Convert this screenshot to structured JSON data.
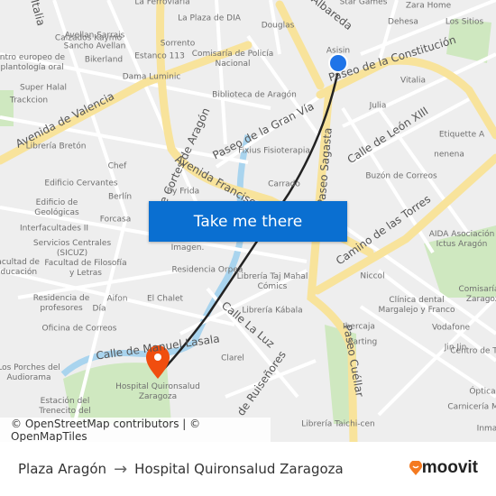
{
  "map": {
    "colors": {
      "major_road": "#f8e39b",
      "minor_road": "#ffffff",
      "river": "#a9d4ee",
      "park": "#cfe8c0",
      "route": "#222222",
      "origin": "#1f74e8",
      "destination": "#f04e0f"
    },
    "streets": [
      "Avenida de Valencia",
      "Calle Cortes de Aragón",
      "Avenida Francisco",
      "Paseo de la Gran Vía",
      "Paseo de la Constitución",
      "Calle de León XIII",
      "Paseo Sagasta",
      "Camino de las Torres",
      "Calle La Luz",
      "Calle de Manuel Lasala",
      "Paseo Cuéllar",
      "de Ruiseñores",
      "Italia",
      "Albareda"
    ],
    "places": [
      "Avellan Sarrais",
      "Sancho Avellan",
      "La Ferroviaria",
      "La Plaza de DIA",
      "Calzados Kaymo",
      "Sorrento",
      "Estanco 113",
      "Comisaría de Policía Nacional",
      "Bikerland",
      "Centro europeo de implantología oral",
      "Dama Luminic",
      "Super Halal",
      "Trackcion",
      "Biblioteca de Aragón",
      "Librería Bretón",
      "Chef",
      "Edificio Cervantes",
      "Berlín",
      "By Frida",
      "Edificio de Geológicas",
      "Forcasa",
      "Interfacultades II",
      "Servicios Centrales (SICUZ)",
      "Facultad de Educación",
      "Facultad de Filosofía y Letras",
      "Residencia de profesores",
      "Aifon",
      "El Chalet",
      "Día",
      "Oficina de Correos",
      "Residencia Orpea",
      "Diagnóstico por Imagen.",
      "Los Porches del Audiorama",
      "Estación del Trenecito del",
      "Hospital Quironsalud Zaragoza",
      "Clarel",
      "Douglas",
      "Star Games",
      "Zara Home",
      "Dehesa",
      "Los Sitios",
      "Vitalia",
      "Julia",
      "Etiquette A",
      "nenena",
      "Fixius Fisioterapia",
      "Buzón de Correos",
      "Carrado",
      "AIDA Asociación Ictus Aragón",
      "Niccol",
      "Comisaría de Zaragoza",
      "Clínica dental Margalejo y Franco",
      "Librería Taj Mahal Cómics",
      "Librería Kábala",
      "Ibercaja",
      "Karting",
      "Vodafone",
      "Jin Jin",
      "Centro de Tenor",
      "Óptica",
      "Carnicería Merzoug",
      "Inma",
      "Librería Taichi-cen",
      "Asisin"
    ]
  },
  "cta_label": "Take me there",
  "attribution": "© OpenStreetMap contributors | © OpenMapTiles",
  "footer": {
    "origin": "Plaza Aragón",
    "arrow": "→",
    "destination": "Hospital Quironsalud Zaragoza",
    "brand": "moovit"
  }
}
